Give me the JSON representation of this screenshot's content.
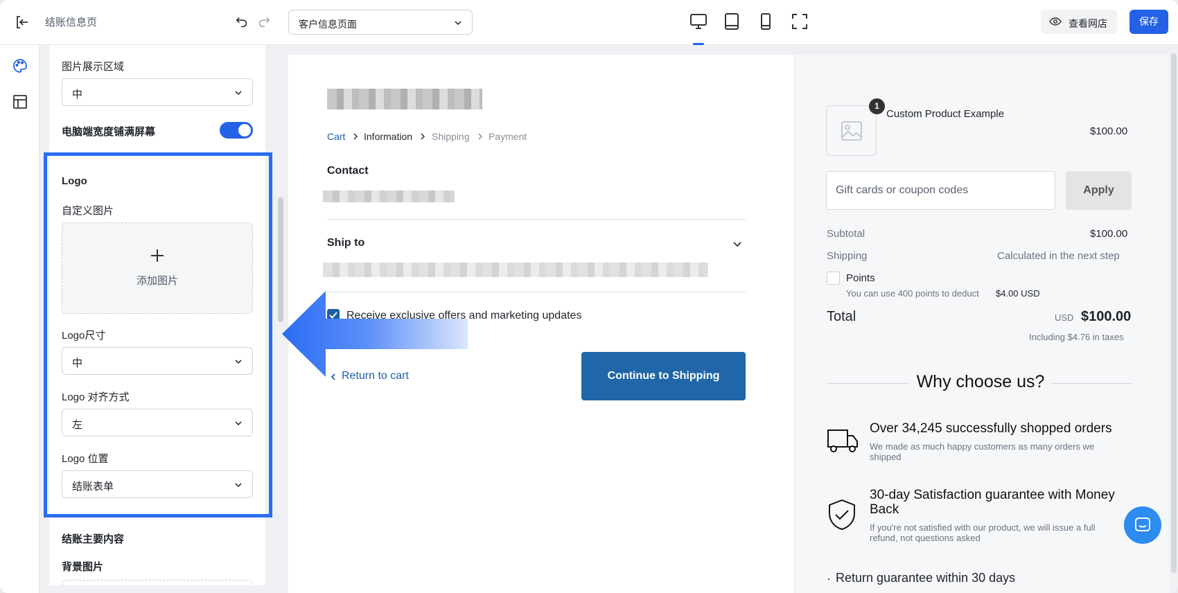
{
  "topbar": {
    "title": "结账信息页",
    "page_select": "客户信息页面",
    "view_store": "查看网店",
    "save": "保存"
  },
  "panel": {
    "image_area_label": "图片展示区域",
    "image_area_value": "中",
    "fullwidth_label": "电脑端宽度铺满屏幕",
    "fullwidth_on": true,
    "logo_section": "Logo",
    "custom_image_label": "自定义图片",
    "add_image": "添加图片",
    "logo_size_label": "Logo尺寸",
    "logo_size_value": "中",
    "logo_align_label": "Logo 对齐方式",
    "logo_align_value": "左",
    "logo_position_label": "Logo 位置",
    "logo_position_value": "结账表单",
    "main_content_section": "结账主要内容",
    "bg_image_label": "背景图片"
  },
  "checkout": {
    "breadcrumb": [
      "Cart",
      "Information",
      "Shipping",
      "Payment"
    ],
    "contact_heading": "Contact",
    "ship_to_heading": "Ship to",
    "marketing_checkbox": "Receive exclusive offers and marketing updates",
    "marketing_checked": true,
    "return_link": "Return to cart",
    "continue_button": "Continue to Shipping"
  },
  "summary": {
    "product_name": "Custom Product Example",
    "product_qty": "1",
    "product_price": "$100.00",
    "coupon_placeholder": "Gift cards or coupon codes",
    "apply": "Apply",
    "subtotal_label": "Subtotal",
    "subtotal_value": "$100.00",
    "shipping_label": "Shipping",
    "shipping_value": "Calculated in the next step",
    "points_label": "Points",
    "points_note": "You can use 400 points to deduct",
    "points_amount": "$4.00 USD",
    "total_label": "Total",
    "total_currency": "USD",
    "total_value": "$100.00",
    "tax_note": "Including $4.76 in taxes",
    "why_heading": "Why choose us?",
    "features": [
      {
        "title": "Over 34,245 successfully shopped orders",
        "desc": "We made as much happy customers as many orders we shipped"
      },
      {
        "title": "30-day Satisfaction guarantee with Money Back",
        "desc": "If you're not satisfied with our product, we will issue a full refund, not questions asked"
      }
    ],
    "return_guarantee": "Return guarantee within 30 days"
  },
  "colors": {
    "accent": "#2561e6",
    "checkout_blue": "#2066a8",
    "highlight": "#2a6df5"
  }
}
